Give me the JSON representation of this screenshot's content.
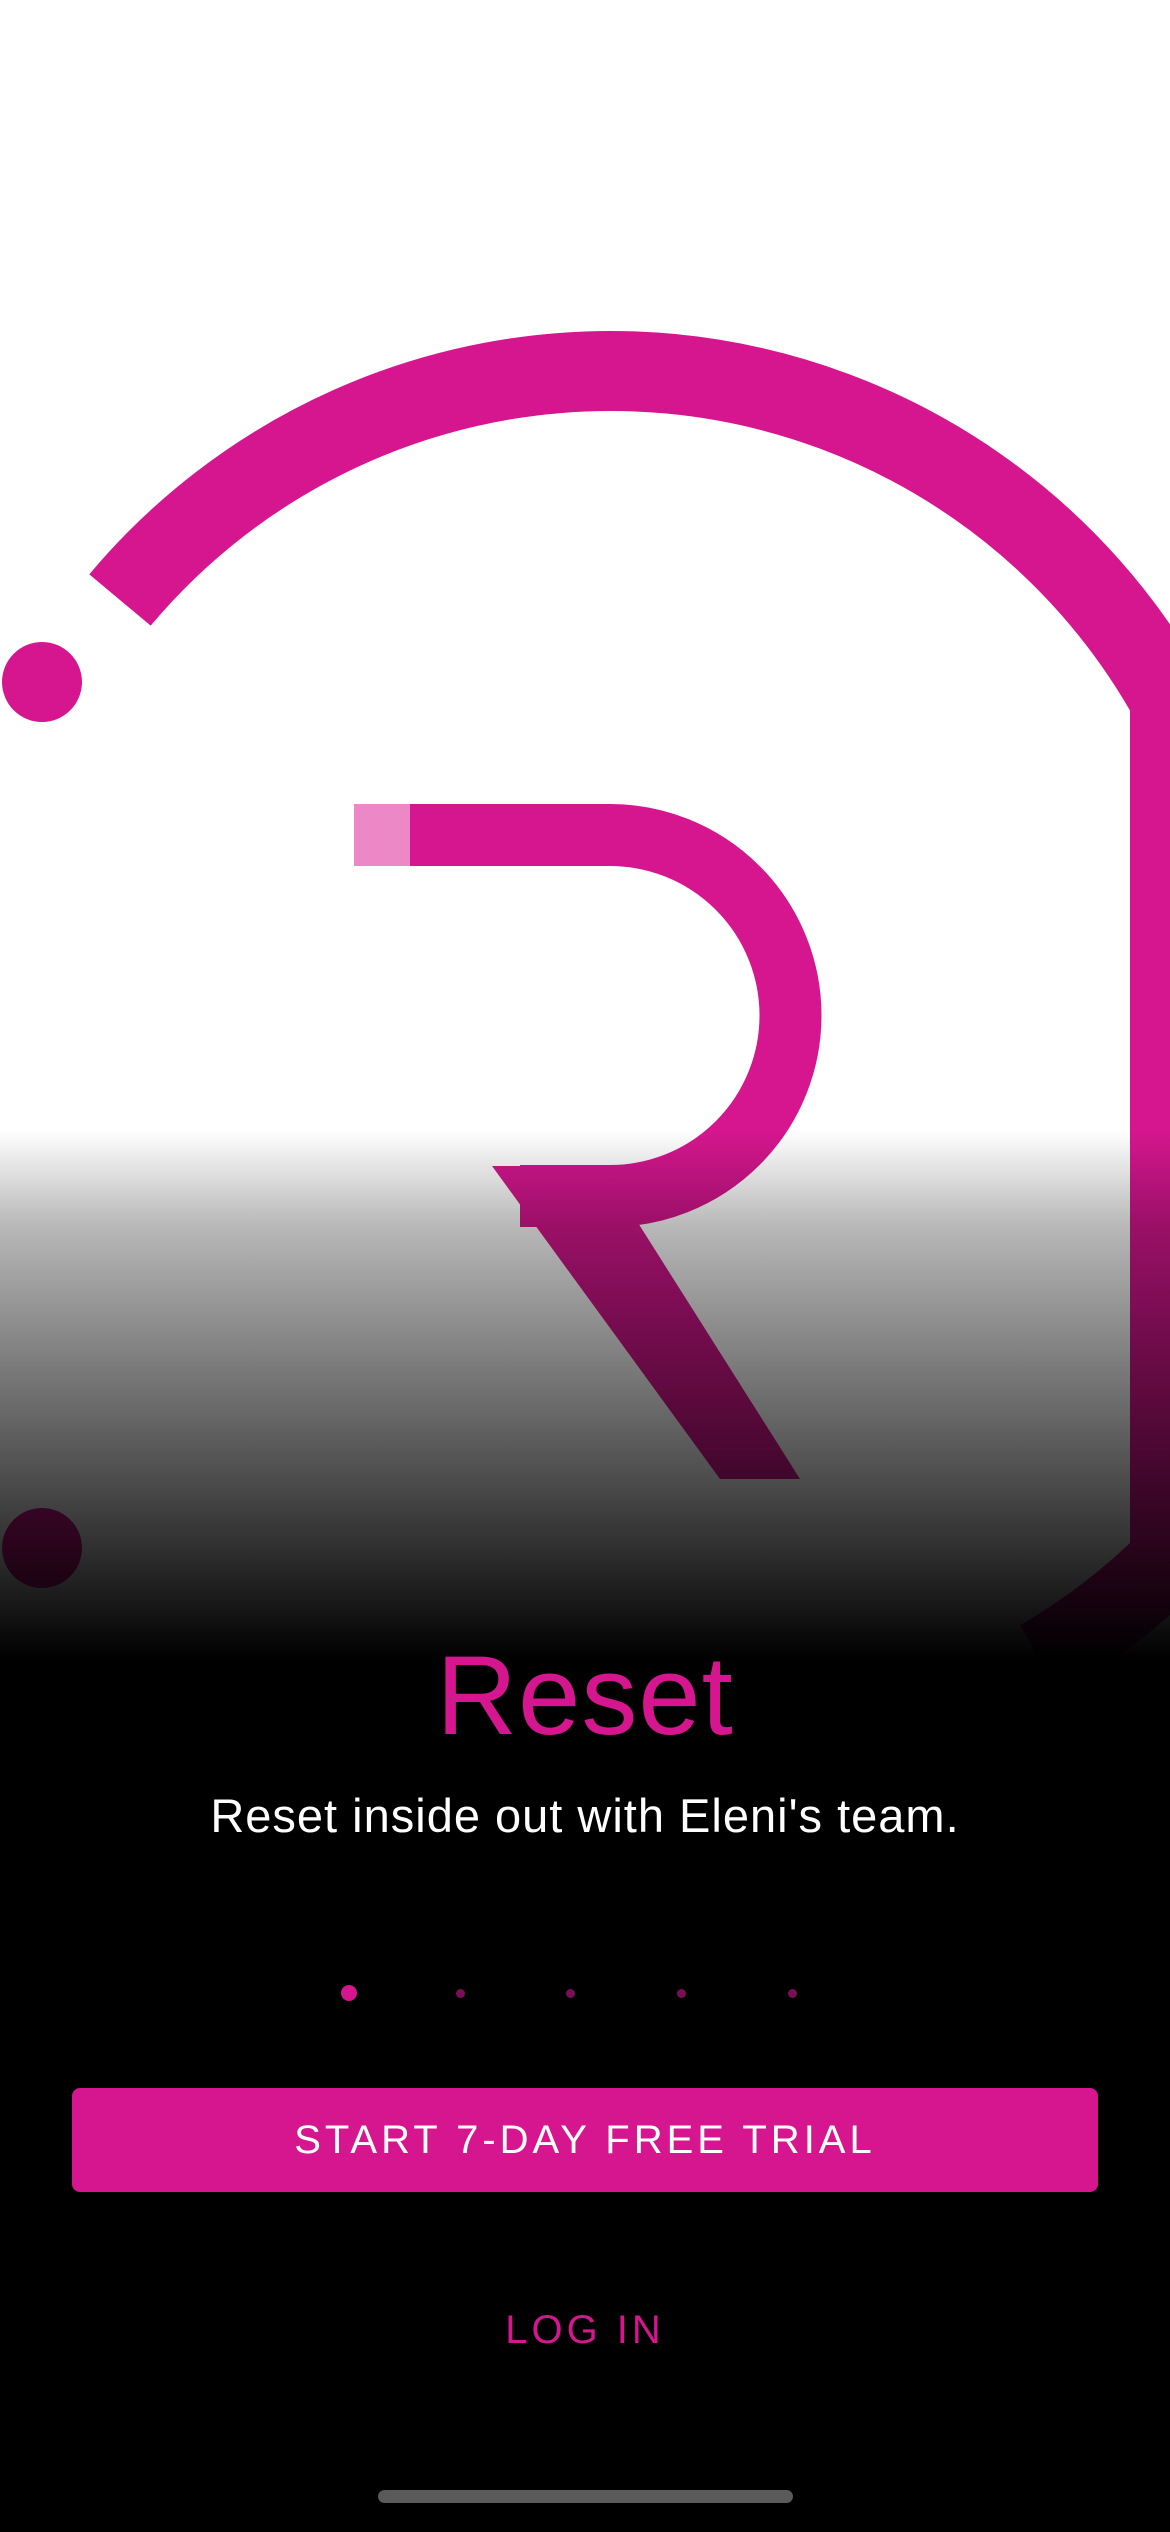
{
  "app": {
    "title": "Reset",
    "subtitle": "Reset inside out with Eleni's team."
  },
  "pager": {
    "total": 5,
    "active_index": 0
  },
  "actions": {
    "primary_label": "START 7-DAY FREE TRIAL",
    "secondary_label": "LOG IN"
  },
  "hero": {
    "icon": "reset-logo-icon"
  },
  "colors": {
    "brand": "#d6168f",
    "brand_light": "#ec88c6",
    "background": "#000000",
    "text": "#ffffff"
  }
}
